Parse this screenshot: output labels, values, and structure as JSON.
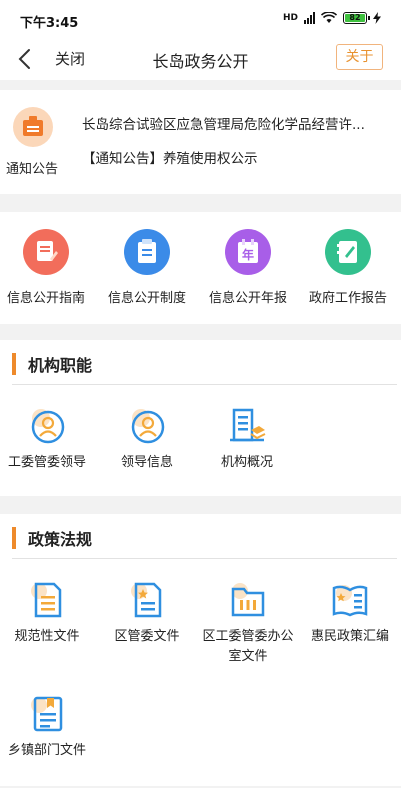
{
  "status": {
    "time": "下午3:45",
    "network": "HD",
    "battery": "82"
  },
  "nav": {
    "close_label": "关闭",
    "title": "长岛政务公开",
    "about_label": "关于"
  },
  "notice": {
    "label": "通知公告",
    "line1": "长岛综合试验区应急管理局危险化学品经营许...",
    "line2": "【通知公告】养殖使用权公示"
  },
  "quick": [
    {
      "label": "信息公开指南",
      "icon": "edit-document-icon",
      "color": "#f26d5b"
    },
    {
      "label": "信息公开制度",
      "icon": "clipboard-icon",
      "color": "#3b8be8"
    },
    {
      "label": "信息公开年报",
      "icon": "annual-report-icon",
      "color": "#a85ee8",
      "glyph": "年"
    },
    {
      "label": "政府工作报告",
      "icon": "report-book-icon",
      "color": "#33c08e"
    }
  ],
  "org": {
    "title": "机构职能",
    "items": [
      {
        "label": "工委管委领导",
        "icon": "leader-icon"
      },
      {
        "label": "领导信息",
        "icon": "person-info-icon"
      },
      {
        "label": "机构概况",
        "icon": "building-icon"
      }
    ]
  },
  "policy": {
    "title": "政策法规",
    "items": [
      {
        "label": "规范性文件",
        "icon": "document-icon"
      },
      {
        "label": "区管委文件",
        "icon": "star-document-icon"
      },
      {
        "label": "区工委管委办公室文件",
        "label_line1": "区工委管委办公",
        "label_line2": "室文件",
        "icon": "folder-icon"
      },
      {
        "label": "惠民政策汇编",
        "icon": "open-book-icon"
      },
      {
        "label": "乡镇部门文件",
        "icon": "bookmark-document-icon"
      }
    ]
  },
  "colors": {
    "accent": "#ee8a2b",
    "icon_blue": "#2f8fe0",
    "icon_orange": "#f3a93a"
  }
}
